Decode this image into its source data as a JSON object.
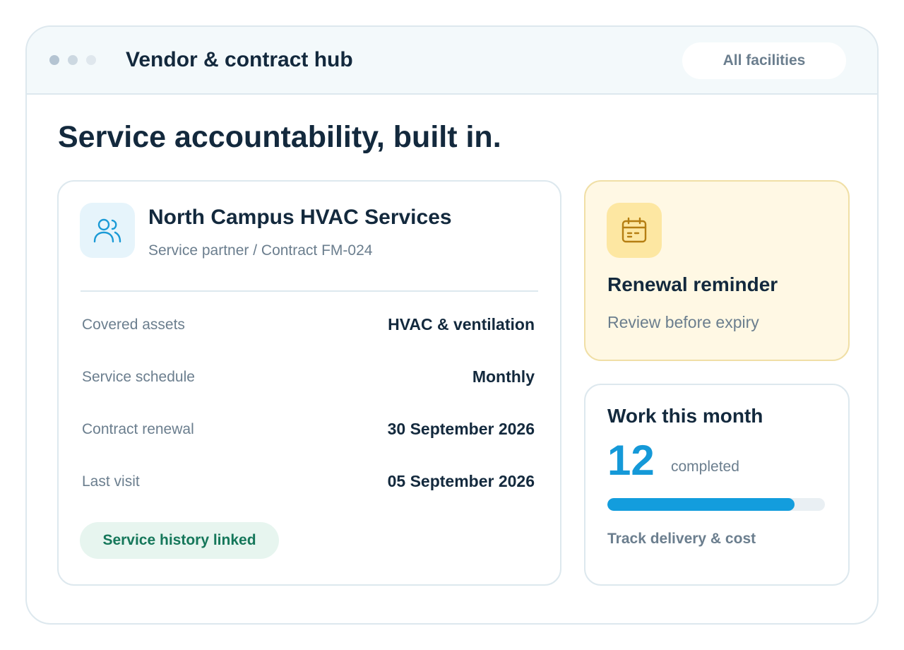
{
  "window": {
    "title": "Vendor & contract hub",
    "facility_filter": "All facilities"
  },
  "headline": "Service accountability, built in.",
  "vendor": {
    "icon": "users-icon",
    "name": "North Campus HVAC Services",
    "subtitle": "Service partner / Contract FM-024",
    "details": [
      {
        "label": "Covered assets",
        "value": "HVAC & ventilation"
      },
      {
        "label": "Service schedule",
        "value": "Monthly"
      },
      {
        "label": "Contract renewal",
        "value": "30 September 2026"
      },
      {
        "label": "Last visit",
        "value": "05 September 2026"
      }
    ],
    "badge": "Service history linked"
  },
  "renewal": {
    "icon": "calendar-icon",
    "title": "Renewal reminder",
    "subtitle": "Review before expiry"
  },
  "work": {
    "title": "Work this month",
    "count": "12",
    "unit": "completed",
    "progress": 0.86,
    "link": "Track delivery & cost"
  },
  "colors": {
    "accent": "#139ddd",
    "success": "#15775a",
    "warning_bg": "#fff8e4",
    "text": "#13293d",
    "muted": "#6b7e8e"
  }
}
